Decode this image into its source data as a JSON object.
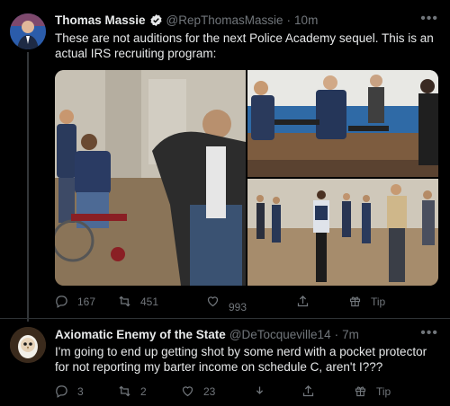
{
  "tweets": [
    {
      "name": "Thomas Massie",
      "handle": "@RepThomasMassie",
      "separator": "·",
      "time": "10m",
      "text": "These are not auditions for the next Police Academy sequel. This is an actual IRS recruiting program:",
      "verified": true,
      "replies": "167",
      "retweets": "451",
      "likes": "993",
      "tip_label": "Tip"
    },
    {
      "name": "Axiomatic Enemy of the State",
      "handle": "@DeTocqueville14",
      "separator": "·",
      "time": "7m",
      "text": "I'm going to end up getting shot by some nerd with a pocket protector for not reporting my barter income on schedule C, aren't I???",
      "verified": false,
      "replies": "3",
      "retweets": "2",
      "likes": "23",
      "tip_label": "Tip"
    }
  ],
  "colors": {
    "background": "#000000",
    "text": "#e7e9ea",
    "muted": "#71767b",
    "verified": "#1d9bf0",
    "divider": "#2f3336"
  },
  "icons": [
    "more-icon",
    "verified-icon",
    "reply-icon",
    "retweet-icon",
    "like-icon",
    "download-icon",
    "share-icon",
    "tip-icon"
  ]
}
